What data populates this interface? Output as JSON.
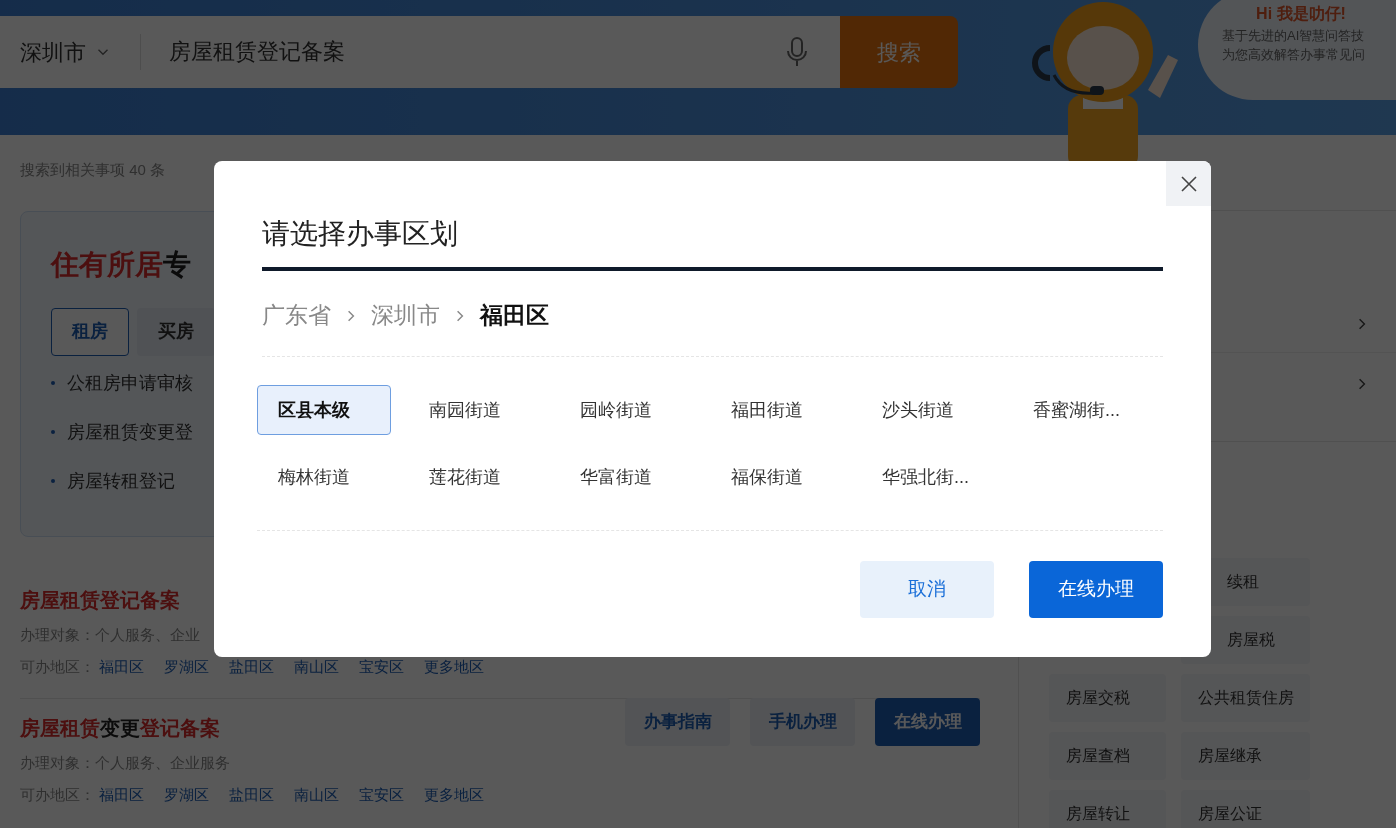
{
  "header": {
    "city": "深圳市",
    "search_query": "房屋租赁登记备案",
    "search_button": "搜索"
  },
  "assistant": {
    "greeting": "Hi 我是叻仔!",
    "lines": [
      "基于先进的AI智慧问答技",
      "为您高效解答办事常见问"
    ]
  },
  "results_count": "搜索到相关事项 40 条",
  "feature": {
    "title_highlight": "住有所居",
    "title_rest": "专",
    "tabs": [
      {
        "label": "租房",
        "selected": true
      },
      {
        "label": "买房",
        "selected": false
      }
    ],
    "links": [
      "公租房申请审核",
      "房屋租赁变更登",
      "房屋转租登记"
    ]
  },
  "results": [
    {
      "title_parts": [
        {
          "text": "房屋租赁登记备案",
          "highlight": true
        }
      ],
      "target_label": "办理对象：",
      "target": "个人服务、企业",
      "region_label": "可办地区：",
      "regions": [
        "福田区",
        "罗湖区",
        "盐田区",
        "南山区",
        "宝安区",
        "更多地区"
      ]
    },
    {
      "title_parts": [
        {
          "text": "房屋租赁",
          "highlight": true
        },
        {
          "text": "变更",
          "highlight": false
        },
        {
          "text": "登记备案",
          "highlight": true
        }
      ],
      "target_label": "办理对象：",
      "target": "个人服务、企业服务",
      "region_label": "可办地区：",
      "regions": [
        "福田区",
        "罗湖区",
        "盐田区",
        "南山区",
        "宝安区",
        "更多地区"
      ],
      "buttons": [
        {
          "label": "办事指南",
          "kind": "plain"
        },
        {
          "label": "手机办理",
          "kind": "plain"
        },
        {
          "label": "在线办理",
          "kind": "primary"
        }
      ]
    }
  ],
  "side_tags": [
    {
      "label": "续租",
      "kind": "cut"
    },
    {
      "label": "房屋税",
      "kind": "cut"
    },
    {
      "label": "房屋交税",
      "kind": "full"
    },
    {
      "label": "公共租赁住房",
      "kind": "full"
    },
    {
      "label": "房屋查档",
      "kind": "full"
    },
    {
      "label": "房屋继承",
      "kind": "full"
    },
    {
      "label": "房屋转让",
      "kind": "full"
    },
    {
      "label": "房屋公证",
      "kind": "full"
    }
  ],
  "dialog": {
    "title": "请选择办事区划",
    "breadcrumb": [
      {
        "label": "广东省",
        "current": false
      },
      {
        "label": "深圳市",
        "current": false
      },
      {
        "label": "福田区",
        "current": true
      }
    ],
    "options": [
      {
        "label": "区县本级",
        "selected": true
      },
      {
        "label": "南园街道",
        "selected": false
      },
      {
        "label": "园岭街道",
        "selected": false
      },
      {
        "label": "福田街道",
        "selected": false
      },
      {
        "label": "沙头街道",
        "selected": false
      },
      {
        "label": "香蜜湖街...",
        "selected": false
      },
      {
        "label": "梅林街道",
        "selected": false
      },
      {
        "label": "莲花街道",
        "selected": false
      },
      {
        "label": "华富街道",
        "selected": false
      },
      {
        "label": "福保街道",
        "selected": false
      },
      {
        "label": "华强北街...",
        "selected": false
      }
    ],
    "cancel": "取消",
    "confirm": "在线办理"
  }
}
